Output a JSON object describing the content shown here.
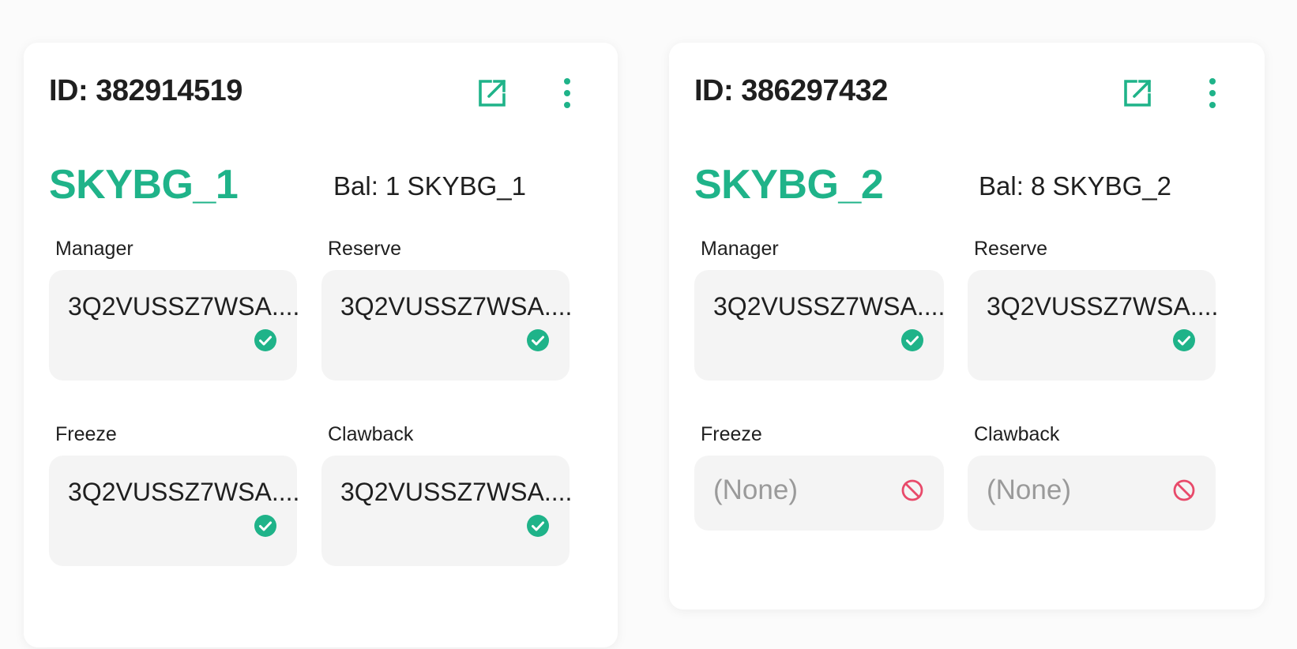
{
  "theme": {
    "accent": "#1fb389",
    "danger": "#e84a6a",
    "box_bg": "#f4f4f4"
  },
  "cards": [
    {
      "id_text": "ID: 382914519",
      "asset_name": "SKYBG_1",
      "balance": "Bal: 1 SKYBG_1",
      "open_icon": "external-link-icon",
      "menu_icon": "more-vertical-icon",
      "fields": [
        {
          "label": "Manager",
          "value": "3Q2VUSSZ7WSA....",
          "status_icon": "check-circle-icon"
        },
        {
          "label": "Reserve",
          "value": "3Q2VUSSZ7WSA....",
          "status_icon": "check-circle-icon"
        },
        {
          "label": "Freeze",
          "value": "3Q2VUSSZ7WSA....",
          "status_icon": "check-circle-icon"
        },
        {
          "label": "Clawback",
          "value": "3Q2VUSSZ7WSA....",
          "status_icon": "check-circle-icon"
        }
      ]
    },
    {
      "id_text": "ID: 386297432",
      "asset_name": "SKYBG_2",
      "balance": "Bal: 8 SKYBG_2",
      "open_icon": "external-link-icon",
      "menu_icon": "more-vertical-icon",
      "fields": [
        {
          "label": "Manager",
          "value": "3Q2VUSSZ7WSA....",
          "status_icon": "check-circle-icon"
        },
        {
          "label": "Reserve",
          "value": "3Q2VUSSZ7WSA....",
          "status_icon": "check-circle-icon"
        },
        {
          "label": "Freeze",
          "value": "(None)",
          "status_icon": "ban-icon"
        },
        {
          "label": "Clawback",
          "value": "(None)",
          "status_icon": "ban-icon"
        }
      ]
    }
  ]
}
